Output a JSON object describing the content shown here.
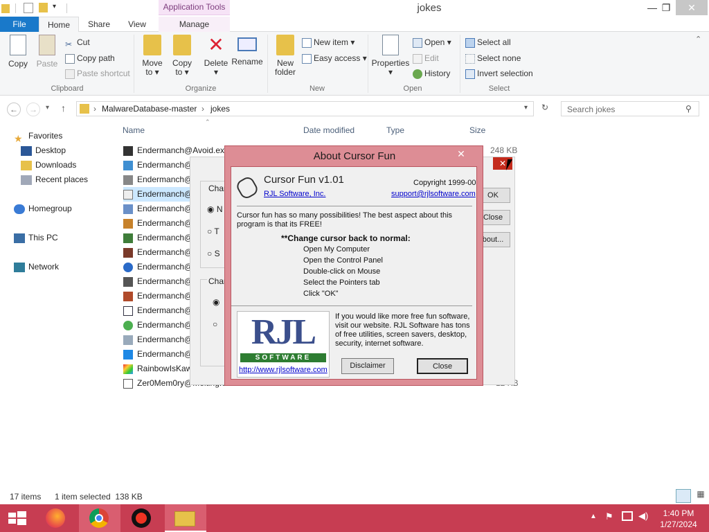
{
  "window": {
    "title": "jokes",
    "contextual_tab": "Application Tools",
    "minimize_icon": "minimize-icon",
    "maximize_icon": "restore-icon",
    "close_icon": "close-icon"
  },
  "ribbon_tabs": {
    "file": "File",
    "home": "Home",
    "share": "Share",
    "view": "View",
    "manage": "Manage"
  },
  "clipboard": {
    "copy": "Copy",
    "paste": "Paste",
    "cut": "Cut",
    "copy_path": "Copy path",
    "paste_shortcut": "Paste shortcut",
    "label": "Clipboard"
  },
  "organize": {
    "move_to_1": "Move",
    "move_to_2": "to ▾",
    "copy_to_1": "Copy",
    "copy_to_2": "to ▾",
    "delete": "Delete",
    "delete_arrow": "▾",
    "rename": "Rename",
    "label": "Organize"
  },
  "new": {
    "folder_1": "New",
    "folder_2": "folder",
    "new_item": "New item ▾",
    "easy_access": "Easy access ▾",
    "label": "New"
  },
  "open": {
    "properties": "Properties",
    "properties_arrow": "▾",
    "open": "Open ▾",
    "edit": "Edit",
    "history": "History",
    "label": "Open"
  },
  "select": {
    "select_all": "Select all",
    "select_none": "Select none",
    "invert": "Invert selection",
    "label": "Select"
  },
  "address": {
    "crumb1": "MalwareDatabase-master",
    "crumb2": "jokes",
    "search_placeholder": "Search jokes"
  },
  "nav": {
    "favorites": "Favorites",
    "desktop": "Desktop",
    "downloads": "Downloads",
    "recent": "Recent places",
    "homegroup": "Homegroup",
    "thispc": "This PC",
    "network": "Network"
  },
  "columns": {
    "name": "Name",
    "date": "Date modified",
    "type": "Type",
    "size": "Size"
  },
  "files": [
    {
      "name": "Endermanch@Avoid.exe",
      "size": "248 KB"
    },
    {
      "name": "Endermanch@",
      "size": ""
    },
    {
      "name": "Endermanch@",
      "size": ""
    },
    {
      "name": "Endermanch@",
      "size": ""
    },
    {
      "name": "Endermanch@",
      "size": ""
    },
    {
      "name": "Endermanch@",
      "size": ""
    },
    {
      "name": "Endermanch@",
      "size": ""
    },
    {
      "name": "Endermanch@",
      "size": ""
    },
    {
      "name": "Endermanch@",
      "size": ""
    },
    {
      "name": "Endermanch@",
      "size": ""
    },
    {
      "name": "Endermanch@",
      "size": ""
    },
    {
      "name": "Endermanch@",
      "size": ""
    },
    {
      "name": "Endermanch@",
      "size": ""
    },
    {
      "name": "Endermanch@",
      "size": ""
    },
    {
      "name": "Endermanch@",
      "size": ""
    },
    {
      "name": "RainbowIsKaw",
      "size": ""
    },
    {
      "name": "Zer0Mem0ry@Melting.e",
      "size": "12 KB"
    }
  ],
  "bg_dialog": {
    "group1": "Chang",
    "opt1": "N",
    "opt2": "T",
    "opt3": "S",
    "group2": "Chang",
    "ok": "OK",
    "close": "Close",
    "about": "bout..."
  },
  "about": {
    "title": "About Cursor Fun",
    "app_name": "Cursor Fun v1.01",
    "copyright": "Copyright 1999-00",
    "company": "RJL Software, Inc.",
    "email": "support@rjlsoftware.com",
    "desc": "Cursor fun has so many possibilities! The best aspect about this program is that its FREE!",
    "heading": "**Change cursor back to normal:",
    "steps": [
      "Open My Computer",
      "Open the Control Panel",
      "Double-click on Mouse",
      "Select the Pointers tab",
      "Click \"OK\""
    ],
    "promo": "If you would like more free fun software, visit our website. RJL Software has tons of free utilities, screen savers, desktop, security, internet software.",
    "logo_text": "RJL",
    "logo_sub": "SOFTWARE",
    "url": "http://www.rjlsoftware.com",
    "disclaimer": "Disclaimer",
    "close": "Close"
  },
  "status": {
    "items": "17 items",
    "selected": "1 item selected  138 KB"
  },
  "taskbar": {
    "time": "1:40 PM",
    "date": "1/27/2024",
    "start_icon": "windows-start-icon"
  },
  "colors": {
    "accent": "#1979ca",
    "taskbar": "#c73d52",
    "dialog": "#dd8d95"
  }
}
